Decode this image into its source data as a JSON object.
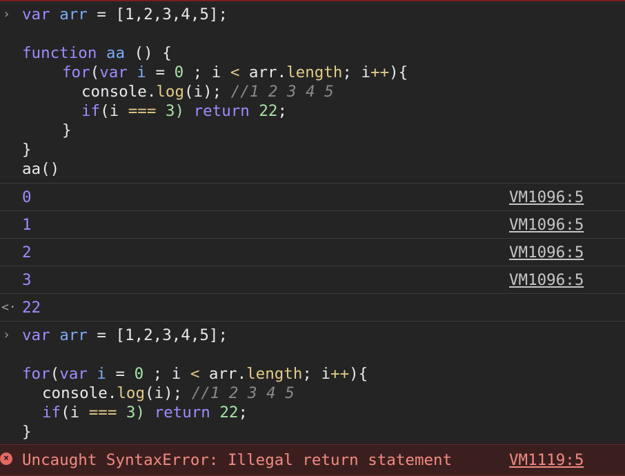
{
  "block1": {
    "line1": {
      "kw_var": "var",
      "id_arr": "arr",
      "op_eq": " = ",
      "arr_literal": "[1,2,3,4,5];"
    },
    "line3": {
      "kw_function": "function",
      "name": "aa",
      "rest": " () {"
    },
    "line4": {
      "kw_for": "for",
      "p1": "(",
      "kw_var": "var",
      "id_i": "i",
      "op_eq": " = ",
      "zero": "0",
      "p2": " ; i ",
      "lt": "<",
      "p3": " arr.",
      "length": "length",
      "p4": "; i",
      "inc": "++",
      "p5": "){"
    },
    "line5": {
      "a": "console.",
      "log": "log",
      "b": "(i); ",
      "comment": "//1 2 3 4 5"
    },
    "line6": {
      "kw_if": "if",
      "a": "(i ",
      "eq3": "===",
      "b": " 3) ",
      "kw_return": "return",
      "val": " 22",
      ";": ";"
    },
    "line7": "}",
    "line8": "}",
    "line9": "aa()"
  },
  "logs": [
    {
      "value": "0",
      "source": "VM1096:5"
    },
    {
      "value": "1",
      "source": "VM1096:5"
    },
    {
      "value": "2",
      "source": "VM1096:5"
    },
    {
      "value": "3",
      "source": "VM1096:5"
    }
  ],
  "return_value": {
    "icon": "<·",
    "value": "22"
  },
  "block2": {
    "line1": {
      "kw_var": "var",
      "id_arr": "arr",
      "op_eq": " = ",
      "arr_literal": "[1,2,3,4,5];"
    },
    "line3": {
      "kw_for": "for",
      "p1": "(",
      "kw_var": "var",
      "id_i": "i",
      "op_eq": " = ",
      "zero": "0",
      "p2": " ; i ",
      "lt": "<",
      "p3": " arr.",
      "length": "length",
      "p4": "; i",
      "inc": "++",
      "p5": "){"
    },
    "line4": {
      "a": "console.",
      "log": "log",
      "b": "(i); ",
      "comment": "//1 2 3 4 5"
    },
    "line5": {
      "kw_if": "if",
      "a": "(i ",
      "eq3": "===",
      "b": " 3) ",
      "kw_return": "return",
      "val": " 22",
      ";": ";"
    },
    "line6": "}"
  },
  "error": {
    "icon": "×",
    "message": "Uncaught SyntaxError: Illegal return statement",
    "source": "VM1119:5"
  },
  "prompt_icon": "›"
}
